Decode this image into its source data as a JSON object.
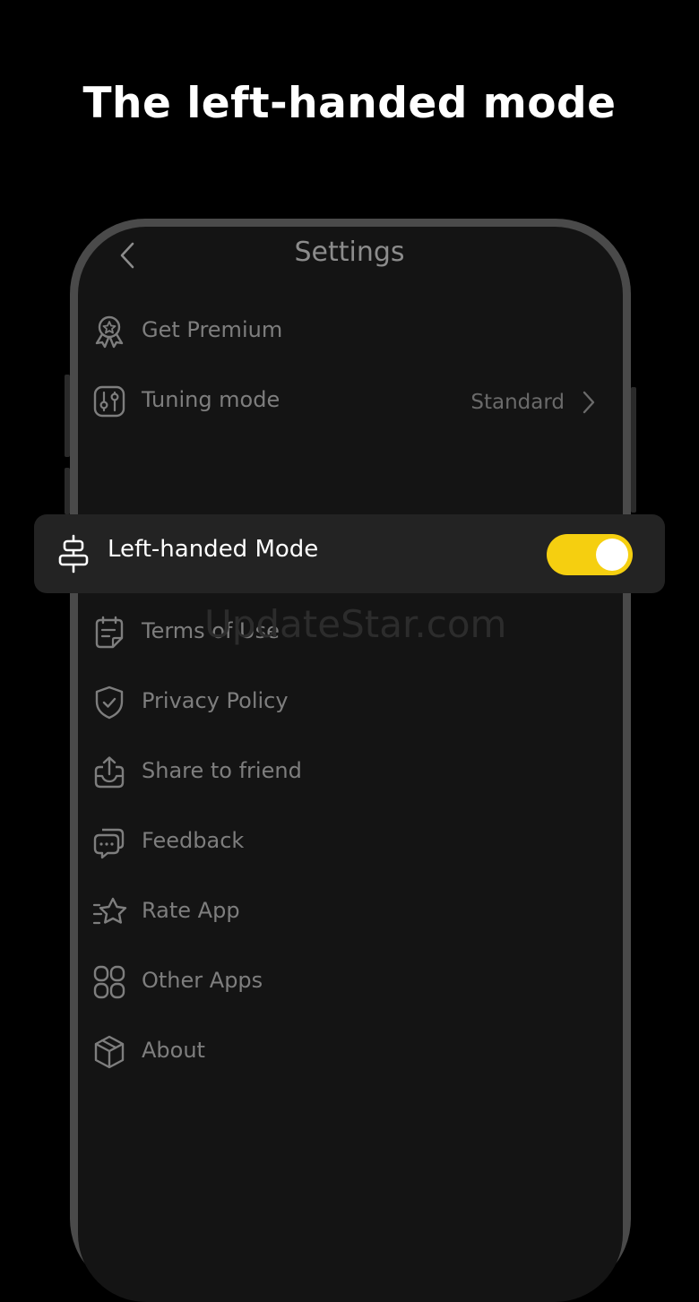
{
  "headline": "The left-handed mode",
  "nav": {
    "title": "Settings",
    "back_icon": "chevron-left-icon"
  },
  "settings": {
    "get_premium": {
      "label": "Get Premium",
      "icon": "award-badge-icon"
    },
    "tuning_mode": {
      "label": "Tuning mode",
      "value": "Standard",
      "icon": "sliders-icon"
    },
    "left_handed": {
      "label": "Left-handed Mode",
      "icon": "align-center-icon",
      "enabled": true
    },
    "terms": {
      "label": "Terms of Use",
      "icon": "document-icon"
    },
    "privacy": {
      "label": "Privacy Policy",
      "icon": "shield-check-icon"
    },
    "share": {
      "label": "Share to friend",
      "icon": "share-upload-icon"
    },
    "feedback": {
      "label": "Feedback",
      "icon": "chat-bubbles-icon"
    },
    "rate": {
      "label": "Rate App",
      "icon": "star-icon"
    },
    "other_apps": {
      "label": "Other Apps",
      "icon": "grid-apps-icon"
    },
    "about": {
      "label": "About",
      "icon": "box-icon"
    }
  },
  "watermark": "UpdateStar.com",
  "colors": {
    "toggle_on": "#f5cf10",
    "background": "#000000",
    "screen": "#141414"
  }
}
